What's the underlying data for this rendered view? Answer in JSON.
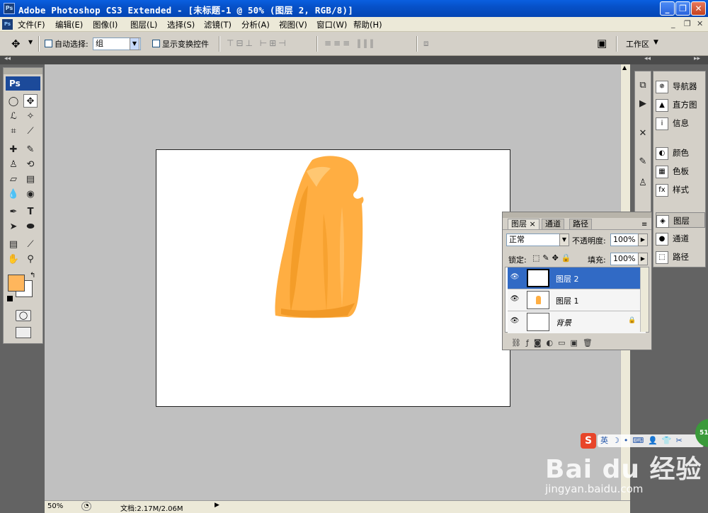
{
  "app": {
    "title": "Adobe Photoshop CS3 Extended - [未标题-1 @ 50% (图层 2, RGB/8)]",
    "logo": "Ps"
  },
  "window_buttons": [
    "_",
    "❐",
    "✕"
  ],
  "menu": [
    "文件(F)",
    "编辑(E)",
    "图像(I)",
    "图层(L)",
    "选择(S)",
    "滤镜(T)",
    "分析(A)",
    "视图(V)",
    "窗口(W)",
    "帮助(H)"
  ],
  "doc_controls": [
    "_",
    "❐",
    "✕"
  ],
  "options": {
    "auto_select_label": "自动选择:",
    "auto_select_value": "组",
    "show_transform_label": "显示变换控件",
    "workspace_label": "工作区"
  },
  "toolbox": {
    "logo": "Ps",
    "fg_color": "#FFB65C",
    "bg_color": "#FFFFFF"
  },
  "panels_right": [
    "导航器",
    "直方图",
    "信息",
    "颜色",
    "色板",
    "样式",
    "图层",
    "通道",
    "路径"
  ],
  "layers_panel": {
    "tabs": [
      "图层",
      "通道",
      "路径"
    ],
    "blend_mode": "正常",
    "opacity_label": "不透明度:",
    "opacity": "100%",
    "lock_label": "锁定:",
    "fill_label": "填充:",
    "fill": "100%",
    "layers": [
      {
        "name": "图层 2",
        "selected": true
      },
      {
        "name": "图层 1",
        "selected": false
      },
      {
        "name": "背景",
        "selected": false
      }
    ]
  },
  "status": {
    "zoom": "50%",
    "doc_info": "文档:2.17M/2.06M"
  },
  "watermark": {
    "brand": "Bai du 经验",
    "url": "jingyan.baidu.com",
    "badge": "51"
  },
  "colors": {
    "popsicle": "#FFAE42",
    "popsicle_dark": "#F29A25",
    "selection": "#316AC5"
  }
}
